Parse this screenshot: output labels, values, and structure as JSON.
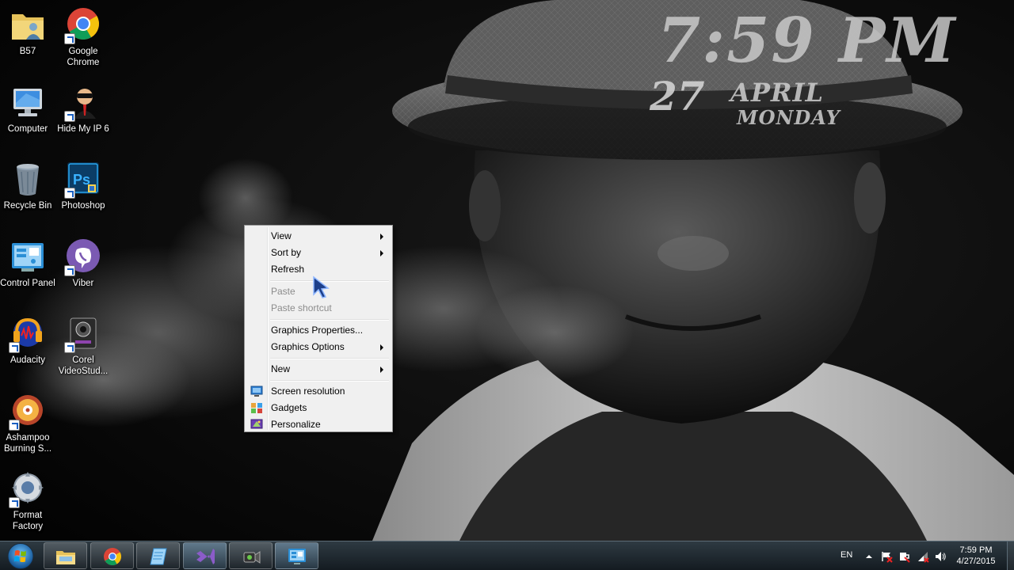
{
  "gadget_clock": {
    "time": "7:59 PM",
    "day": "27",
    "month": "APRIL",
    "weekday": "MONDAY"
  },
  "desktop_icons": [
    {
      "label": "B57",
      "icon": "folder-user-icon"
    },
    {
      "label": "Google Chrome",
      "icon": "chrome-icon"
    },
    {
      "label": "Computer",
      "icon": "computer-icon"
    },
    {
      "label": "Hide My IP 6",
      "icon": "hide-my-ip-icon"
    },
    {
      "label": "Recycle Bin",
      "icon": "recycle-bin-icon"
    },
    {
      "label": "Photoshop",
      "icon": "photoshop-icon"
    },
    {
      "label": "Control Panel",
      "icon": "control-panel-icon"
    },
    {
      "label": "Viber",
      "icon": "viber-icon"
    },
    {
      "label": "Audacity",
      "icon": "audacity-icon"
    },
    {
      "label": "Corel VideoStud...",
      "icon": "corel-videostudio-icon"
    },
    {
      "label": "Ashampoo Burning S...",
      "icon": "ashampoo-icon"
    },
    {
      "label": "Format Factory",
      "icon": "format-factory-icon"
    }
  ],
  "context_menu": {
    "view": "View",
    "sort_by": "Sort by",
    "refresh": "Refresh",
    "paste": "Paste",
    "paste_shortcut": "Paste shortcut",
    "graphics_properties": "Graphics Properties...",
    "graphics_options": "Graphics Options",
    "new": "New",
    "screen_resolution": "Screen resolution",
    "gadgets": "Gadgets",
    "personalize": "Personalize"
  },
  "taskbar": {
    "start_icon": "windows-start-icon",
    "pinned": [
      {
        "name": "windows-explorer",
        "icon": "folder-icon"
      },
      {
        "name": "google-chrome",
        "icon": "chrome-icon"
      },
      {
        "name": "app-blue",
        "icon": "notepad-icon"
      },
      {
        "name": "visual-studio",
        "icon": "visual-studio-icon"
      },
      {
        "name": "camcorder",
        "icon": "camera-icon"
      },
      {
        "name": "control-panel",
        "icon": "control-panel-icon"
      }
    ],
    "language": "EN",
    "tray_time": "7:59 PM",
    "tray_date": "4/27/2015"
  }
}
